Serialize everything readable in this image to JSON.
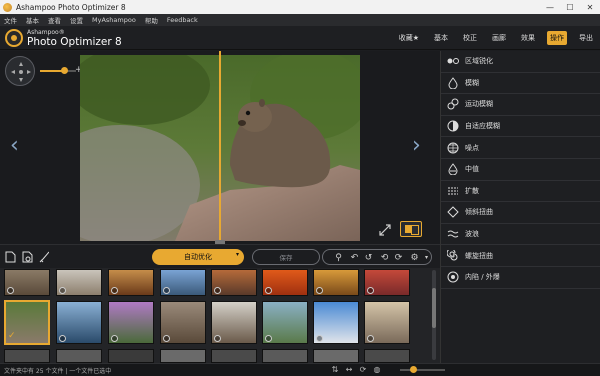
{
  "window": {
    "title": "Ashampoo Photo Optimizer 8",
    "controls": [
      "—",
      "☐",
      "✕"
    ]
  },
  "menu": {
    "items": [
      "文件",
      "基本",
      "查看",
      "设置",
      "MyAshampoo",
      "帮助",
      "Feedback"
    ]
  },
  "brand": {
    "small": "Ashampoo®",
    "big": "Photo Optimizer 8"
  },
  "nav": {
    "items": [
      "收藏★",
      "基本",
      "校正",
      "画廊",
      "效果",
      "操作",
      "导出"
    ],
    "active": "操作"
  },
  "viewer": {
    "prev": "‹",
    "next": "›",
    "zoom": "+"
  },
  "panel": {
    "items": [
      {
        "label": "区域锐化",
        "icon": "dots-icon"
      },
      {
        "label": "模糊",
        "icon": "drop-icon"
      },
      {
        "label": "运动模糊",
        "icon": "motion-blur-icon"
      },
      {
        "label": "自适应模糊",
        "icon": "adaptive-blur-icon"
      },
      {
        "label": "噪点",
        "icon": "noise-icon"
      },
      {
        "label": "中值",
        "icon": "median-icon"
      },
      {
        "label": "扩散",
        "icon": "diffuse-icon"
      },
      {
        "label": "倾斜扭曲",
        "icon": "skew-icon"
      },
      {
        "label": "波浪",
        "icon": "wave-icon"
      },
      {
        "label": "螺旋扭曲",
        "icon": "swirl-icon"
      },
      {
        "label": "内陷 / 外爆",
        "icon": "pinch-icon"
      }
    ]
  },
  "toolbar": {
    "auto_label": "自动优化",
    "save_label": "保存"
  },
  "status": {
    "text": "文件夹中有 25 个文件 | 一个文件已选中"
  },
  "colors": {
    "accent": "#e8a931",
    "background": "#1c1d20"
  }
}
